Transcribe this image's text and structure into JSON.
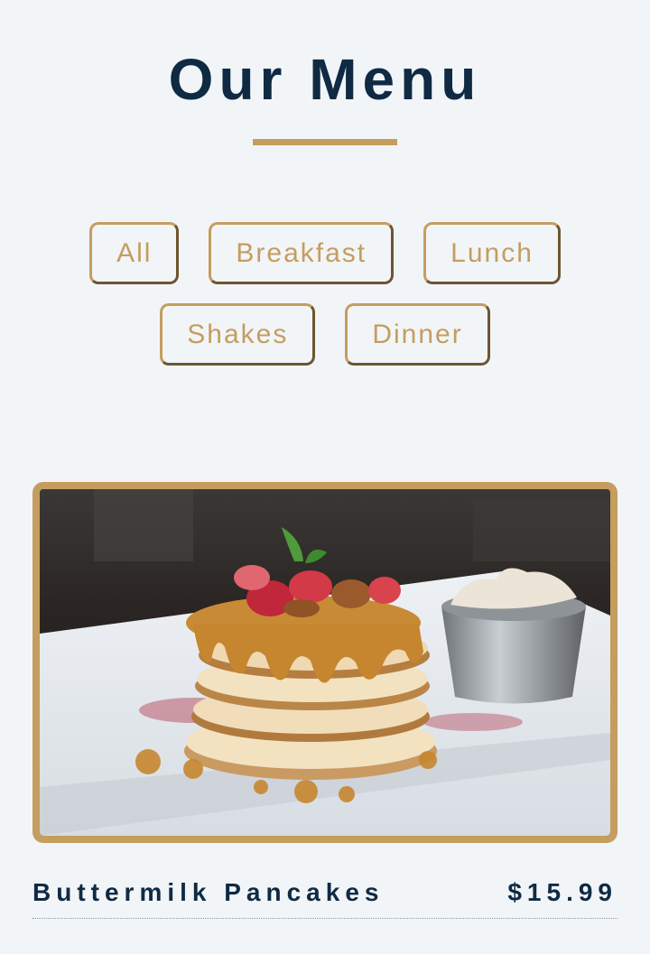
{
  "header": {
    "title": "Our Menu"
  },
  "filters": [
    {
      "label": "All"
    },
    {
      "label": "Breakfast"
    },
    {
      "label": "Lunch"
    },
    {
      "label": "Shakes"
    },
    {
      "label": "Dinner"
    }
  ],
  "menu_item": {
    "name": "Buttermilk Pancakes",
    "price": "$15.99"
  },
  "colors": {
    "accent": "#c59d5f",
    "heading": "#102a43",
    "background": "#f1f5f8"
  }
}
